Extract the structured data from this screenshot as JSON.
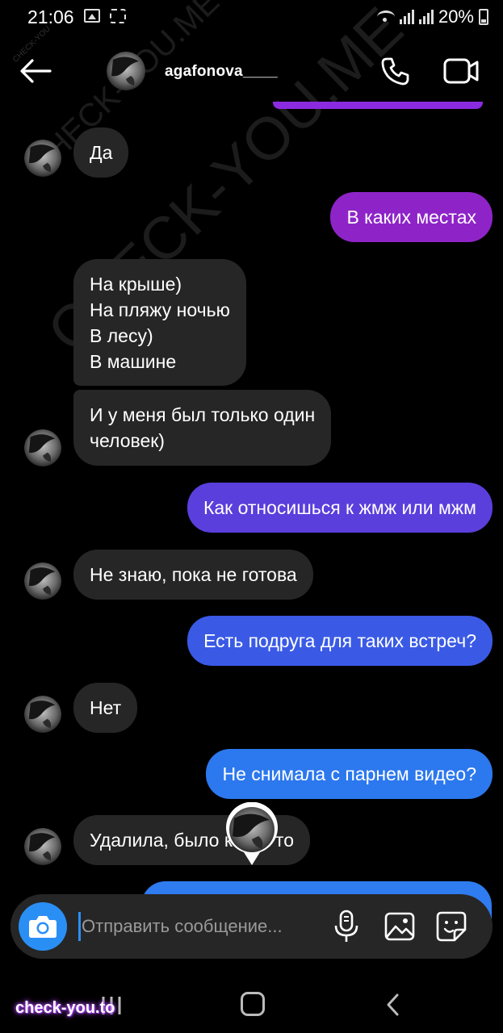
{
  "status_bar": {
    "time": "21:06",
    "battery": "20%"
  },
  "header": {
    "username": "agafonova____",
    "back_icon": "arrow-left-icon",
    "call_icon": "phone-icon",
    "video_icon": "video-camera-icon"
  },
  "messages": [
    {
      "direction": "in",
      "lines": [
        "Да"
      ]
    },
    {
      "direction": "out",
      "lines": [
        "В каких местах"
      ],
      "color": "#8e24c8"
    },
    {
      "direction": "in",
      "lines": [
        "На крыше)",
        "На пляжу ночью",
        "В лесу)",
        "В машине"
      ]
    },
    {
      "direction": "in",
      "lines": [
        "И у меня был только один",
        "человек)"
      ]
    },
    {
      "direction": "out",
      "lines": [
        "Как относишься к жмж или мжм"
      ],
      "color": "#5a3fdc"
    },
    {
      "direction": "in",
      "lines": [
        "Не знаю, пока не готова"
      ]
    },
    {
      "direction": "out",
      "lines": [
        "Есть подруга для таких встреч?"
      ],
      "color": "#3a5ae6"
    },
    {
      "direction": "in",
      "lines": [
        "Нет"
      ]
    },
    {
      "direction": "out",
      "lines": [
        "Не снимала с парнем видео?"
      ],
      "color": "#2c78ee"
    },
    {
      "direction": "in",
      "lines": [
        "Удалила, было когда то"
      ]
    }
  ],
  "composer": {
    "placeholder": "Отправить сообщение...",
    "camera_icon": "camera-icon",
    "mic_icon": "microphone-icon",
    "gallery_icon": "image-icon",
    "sticker_icon": "sticker-icon"
  },
  "watermarks": {
    "large": "CHECK-YOU.ME",
    "small": "CHECK-YOU.ME",
    "tiny": "CHECK-YOU",
    "brand": "check-you.to"
  }
}
